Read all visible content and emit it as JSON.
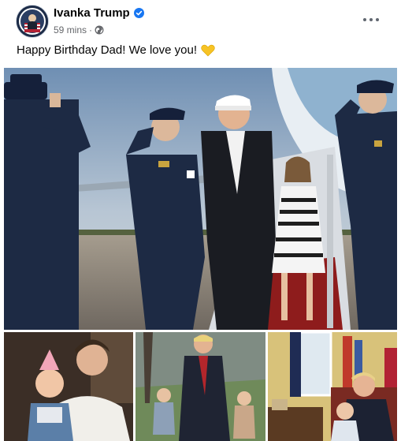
{
  "post": {
    "author_name": "Ivanka Trump",
    "time_label": "59 mins",
    "separator": "·",
    "visibility_icon": "globe-icon",
    "verified_icon": "verified-badge-icon",
    "text": "Happy Birthday Dad! We love you!",
    "emoji_icon": "yellow-heart-icon"
  },
  "colors": {
    "verified": "#1877f2",
    "meta_text": "#65676b",
    "heart": "#f7c325"
  },
  "photos": {
    "count": 4
  }
}
